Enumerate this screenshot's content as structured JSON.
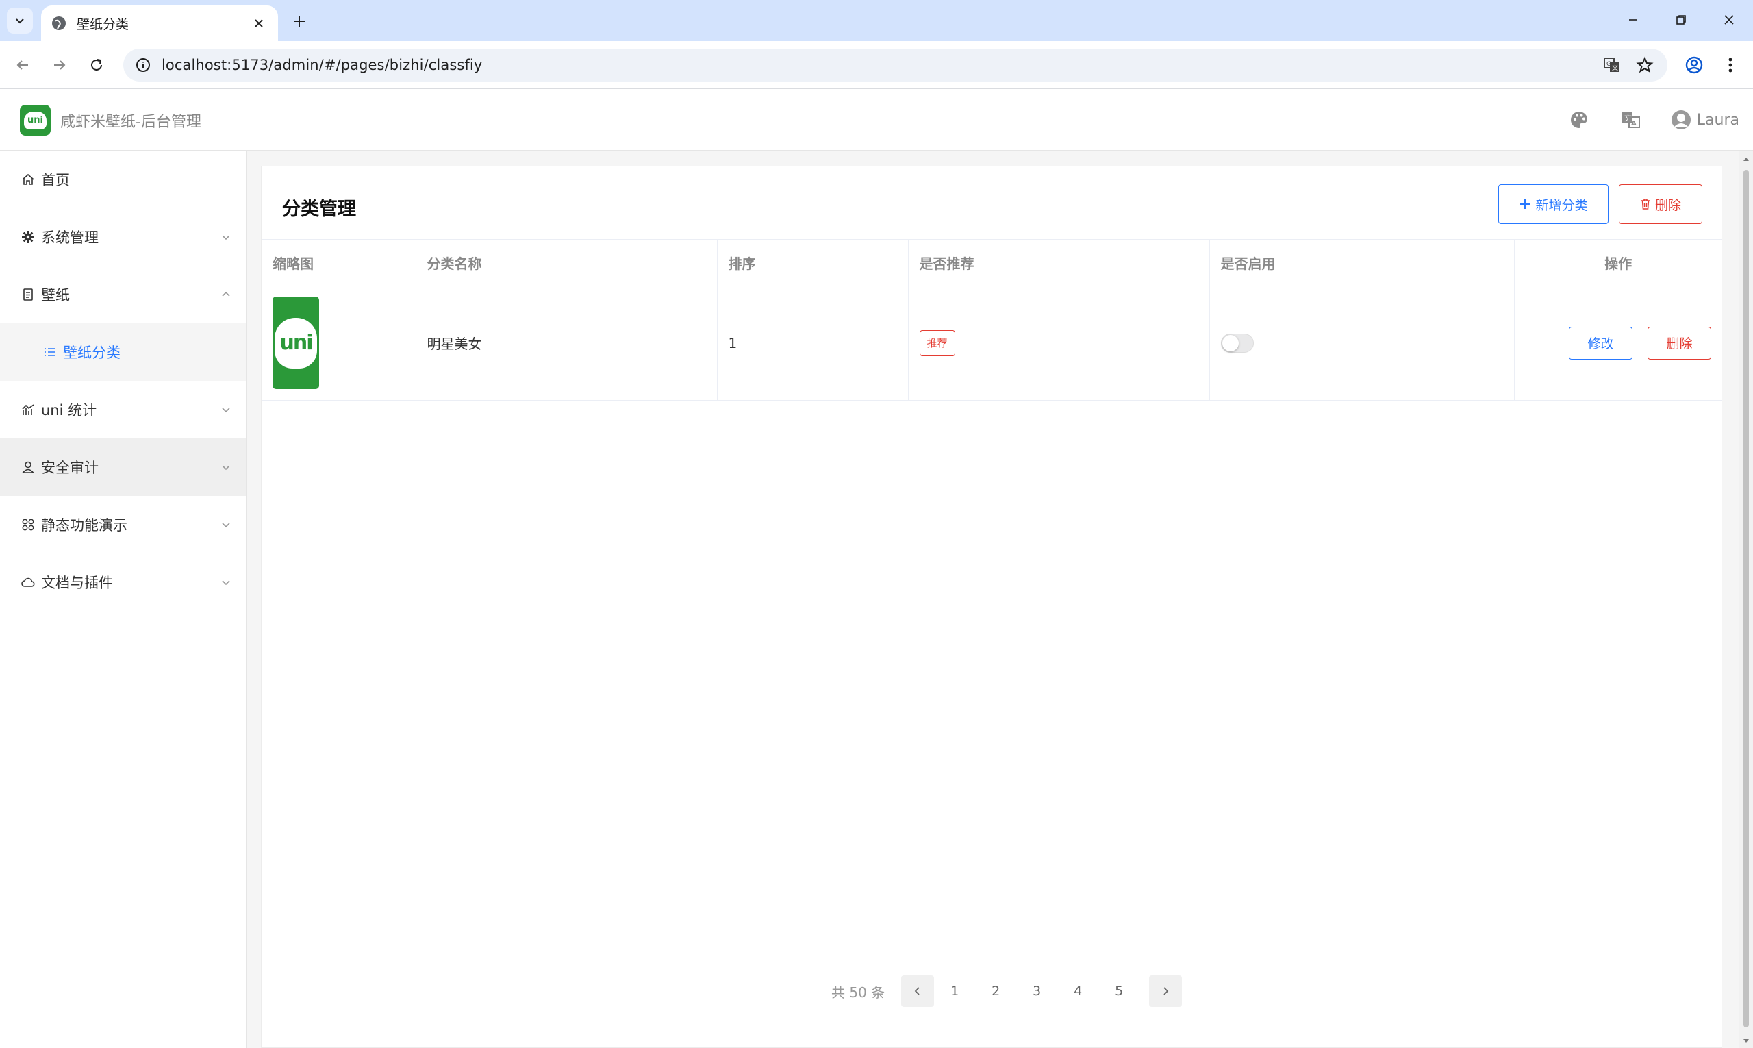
{
  "browser": {
    "tab_title": "壁纸分类",
    "url": "localhost:5173/admin/#/pages/bizhi/classfiy"
  },
  "header": {
    "app_title": "咸虾米壁纸-后台管理",
    "logo_text": "uni",
    "user_name": "Laura"
  },
  "sidebar": {
    "items": [
      {
        "label": "首页",
        "icon": "home-icon"
      },
      {
        "label": "系统管理",
        "icon": "gear-icon"
      },
      {
        "label": "壁纸",
        "icon": "document-icon"
      },
      {
        "label": "壁纸分类",
        "icon": "list-icon"
      },
      {
        "label": "uni 统计",
        "icon": "chart-icon"
      },
      {
        "label": "安全审计",
        "icon": "person-icon"
      },
      {
        "label": "静态功能演示",
        "icon": "grid-icon"
      },
      {
        "label": "文档与插件",
        "icon": "cloud-icon"
      }
    ]
  },
  "page": {
    "title": "分类管理",
    "add_button": "新增分类",
    "delete_button": "删除"
  },
  "table": {
    "columns": [
      "缩略图",
      "分类名称",
      "排序",
      "是否推荐",
      "是否启用",
      "操作"
    ],
    "rows": [
      {
        "thumb_text": "uni",
        "name": "明星美女",
        "sort": "1",
        "recommend_tag": "推荐",
        "enabled": false,
        "edit_label": "修改",
        "delete_label": "删除"
      }
    ]
  },
  "pagination": {
    "total": "共 50 条",
    "pages": [
      "1",
      "2",
      "3",
      "4",
      "5"
    ]
  },
  "colors": {
    "primary": "#2979ff",
    "danger": "#e43d33",
    "brand_green": "#2b9939"
  }
}
